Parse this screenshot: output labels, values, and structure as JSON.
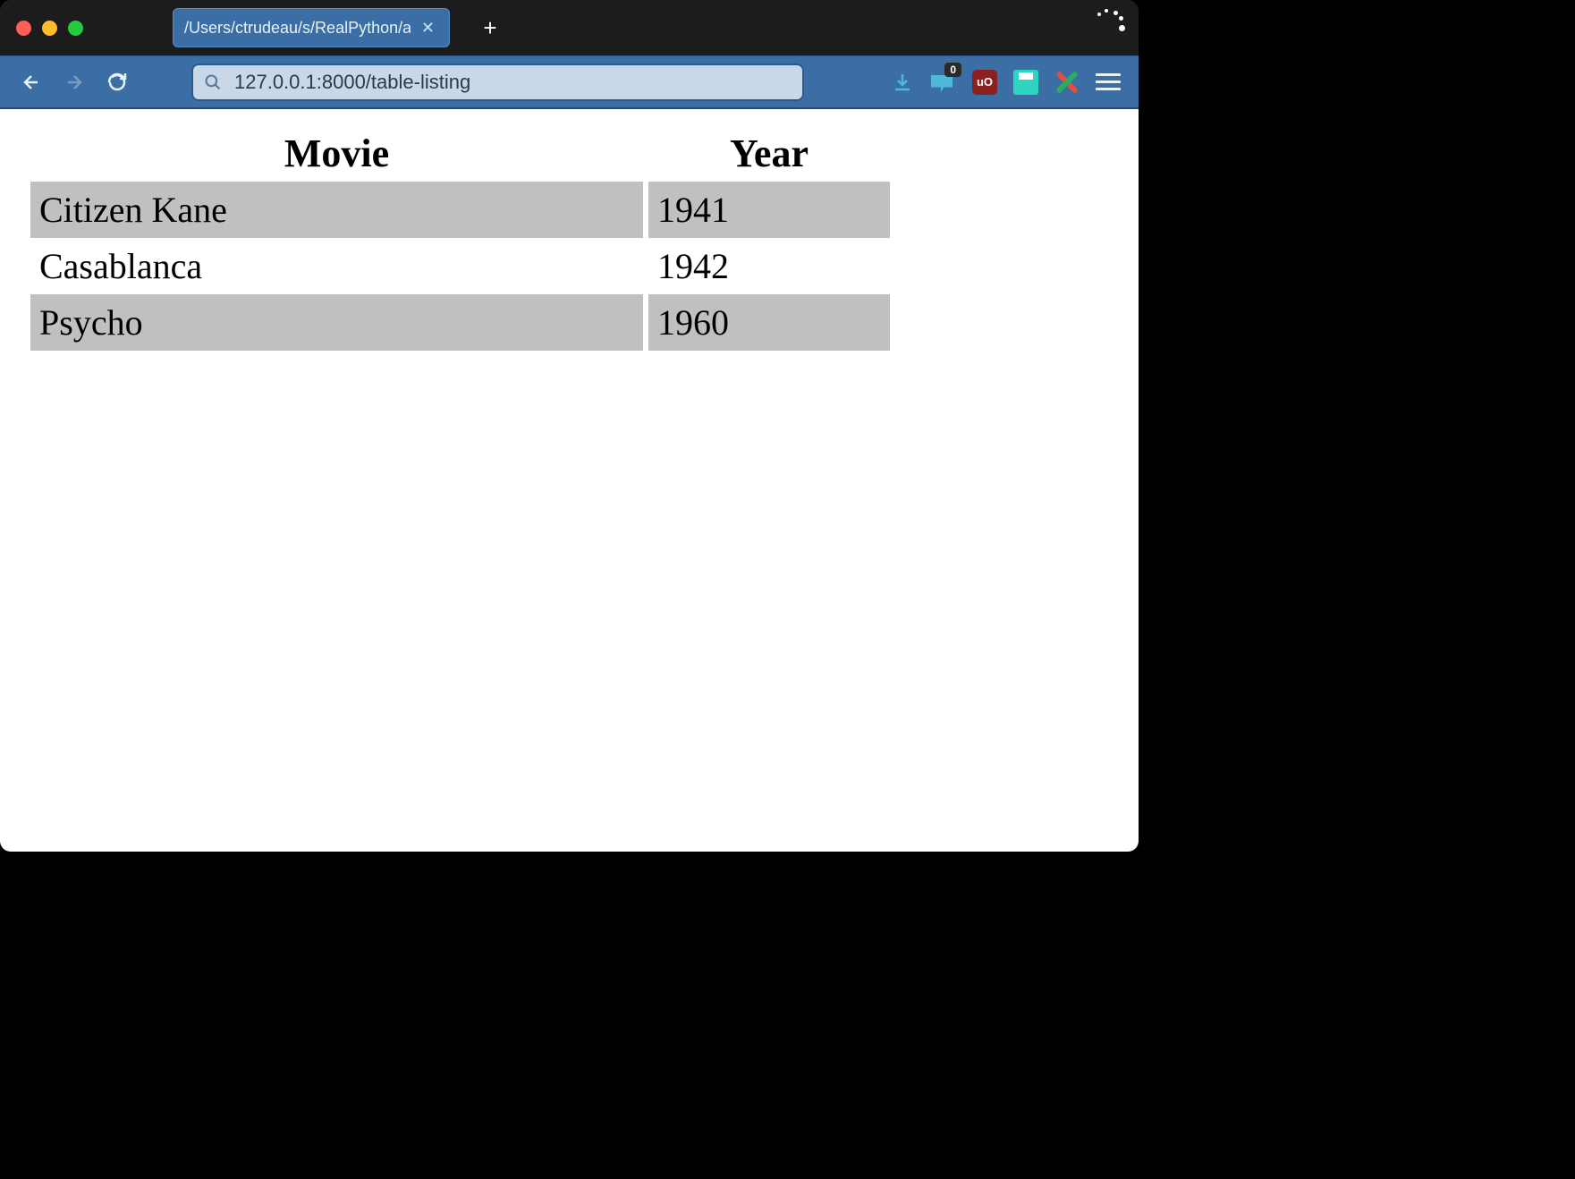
{
  "browser": {
    "tab_title": "/Users/ctrudeau/s/RealPython/articl",
    "url": "127.0.0.1:8000/table-listing",
    "notification_count": "0",
    "ublock_label": "uO"
  },
  "table": {
    "headers": {
      "movie": "Movie",
      "year": "Year"
    },
    "rows": [
      {
        "movie": "Citizen Kane",
        "year": "1941"
      },
      {
        "movie": "Casablanca",
        "year": "1942"
      },
      {
        "movie": "Psycho",
        "year": "1960"
      }
    ]
  }
}
